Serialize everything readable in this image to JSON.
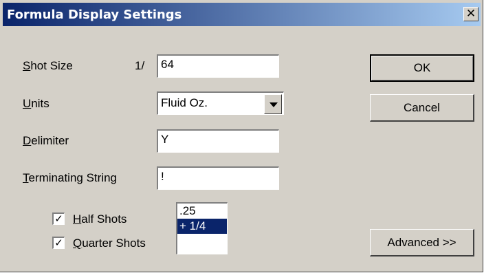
{
  "dialog": {
    "title": "Formula Display Settings",
    "close_glyph": "✕"
  },
  "shot_size": {
    "label_mnemonic": "S",
    "label_rest": "hot Size",
    "prefix": "1/",
    "value": "64"
  },
  "units": {
    "label_mnemonic": "U",
    "label_rest": "nits",
    "value": "Fluid Oz."
  },
  "delimiter": {
    "label_mnemonic": "D",
    "label_rest": "elimiter",
    "value": "Y"
  },
  "terminating": {
    "label_mnemonic": "T",
    "label_rest": "erminating String",
    "value": "!"
  },
  "half_shots": {
    "label_mnemonic": "H",
    "label_rest": "alf Shots",
    "checked_glyph": "✓"
  },
  "quarter_shots": {
    "label_mnemonic": "Q",
    "label_rest": "uarter Shots",
    "checked_glyph": "✓"
  },
  "fraction_list": {
    "items": [
      ".25",
      "+ 1/4"
    ],
    "selected_index": 1
  },
  "buttons": {
    "ok": "OK",
    "cancel": "Cancel",
    "advanced": "Advanced >>"
  }
}
